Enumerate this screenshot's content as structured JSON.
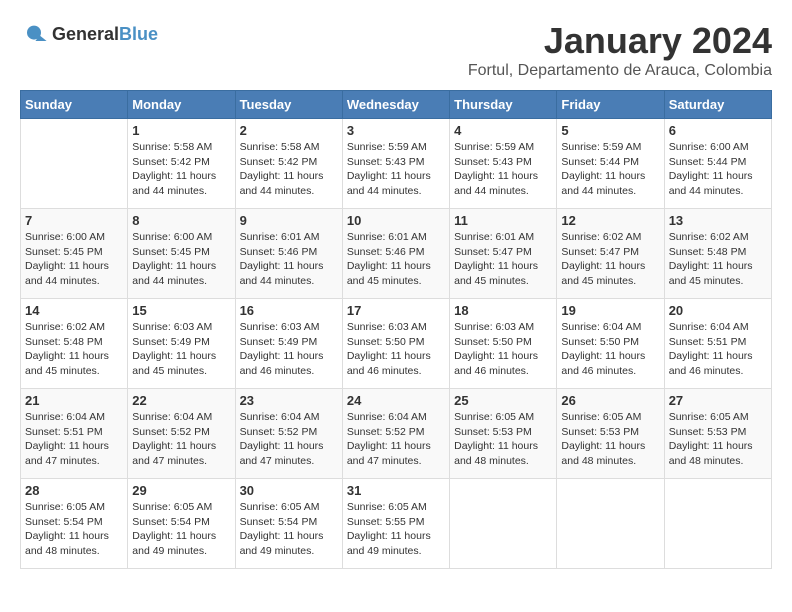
{
  "header": {
    "logo_general": "General",
    "logo_blue": "Blue",
    "month_title": "January 2024",
    "location": "Fortul, Departamento de Arauca, Colombia"
  },
  "days_of_week": [
    "Sunday",
    "Monday",
    "Tuesday",
    "Wednesday",
    "Thursday",
    "Friday",
    "Saturday"
  ],
  "weeks": [
    [
      {
        "day": "",
        "info": ""
      },
      {
        "day": "1",
        "info": "Sunrise: 5:58 AM\nSunset: 5:42 PM\nDaylight: 11 hours\nand 44 minutes."
      },
      {
        "day": "2",
        "info": "Sunrise: 5:58 AM\nSunset: 5:42 PM\nDaylight: 11 hours\nand 44 minutes."
      },
      {
        "day": "3",
        "info": "Sunrise: 5:59 AM\nSunset: 5:43 PM\nDaylight: 11 hours\nand 44 minutes."
      },
      {
        "day": "4",
        "info": "Sunrise: 5:59 AM\nSunset: 5:43 PM\nDaylight: 11 hours\nand 44 minutes."
      },
      {
        "day": "5",
        "info": "Sunrise: 5:59 AM\nSunset: 5:44 PM\nDaylight: 11 hours\nand 44 minutes."
      },
      {
        "day": "6",
        "info": "Sunrise: 6:00 AM\nSunset: 5:44 PM\nDaylight: 11 hours\nand 44 minutes."
      }
    ],
    [
      {
        "day": "7",
        "info": "Sunrise: 6:00 AM\nSunset: 5:45 PM\nDaylight: 11 hours\nand 44 minutes."
      },
      {
        "day": "8",
        "info": "Sunrise: 6:00 AM\nSunset: 5:45 PM\nDaylight: 11 hours\nand 44 minutes."
      },
      {
        "day": "9",
        "info": "Sunrise: 6:01 AM\nSunset: 5:46 PM\nDaylight: 11 hours\nand 44 minutes."
      },
      {
        "day": "10",
        "info": "Sunrise: 6:01 AM\nSunset: 5:46 PM\nDaylight: 11 hours\nand 45 minutes."
      },
      {
        "day": "11",
        "info": "Sunrise: 6:01 AM\nSunset: 5:47 PM\nDaylight: 11 hours\nand 45 minutes."
      },
      {
        "day": "12",
        "info": "Sunrise: 6:02 AM\nSunset: 5:47 PM\nDaylight: 11 hours\nand 45 minutes."
      },
      {
        "day": "13",
        "info": "Sunrise: 6:02 AM\nSunset: 5:48 PM\nDaylight: 11 hours\nand 45 minutes."
      }
    ],
    [
      {
        "day": "14",
        "info": "Sunrise: 6:02 AM\nSunset: 5:48 PM\nDaylight: 11 hours\nand 45 minutes."
      },
      {
        "day": "15",
        "info": "Sunrise: 6:03 AM\nSunset: 5:49 PM\nDaylight: 11 hours\nand 45 minutes."
      },
      {
        "day": "16",
        "info": "Sunrise: 6:03 AM\nSunset: 5:49 PM\nDaylight: 11 hours\nand 46 minutes."
      },
      {
        "day": "17",
        "info": "Sunrise: 6:03 AM\nSunset: 5:50 PM\nDaylight: 11 hours\nand 46 minutes."
      },
      {
        "day": "18",
        "info": "Sunrise: 6:03 AM\nSunset: 5:50 PM\nDaylight: 11 hours\nand 46 minutes."
      },
      {
        "day": "19",
        "info": "Sunrise: 6:04 AM\nSunset: 5:50 PM\nDaylight: 11 hours\nand 46 minutes."
      },
      {
        "day": "20",
        "info": "Sunrise: 6:04 AM\nSunset: 5:51 PM\nDaylight: 11 hours\nand 46 minutes."
      }
    ],
    [
      {
        "day": "21",
        "info": "Sunrise: 6:04 AM\nSunset: 5:51 PM\nDaylight: 11 hours\nand 47 minutes."
      },
      {
        "day": "22",
        "info": "Sunrise: 6:04 AM\nSunset: 5:52 PM\nDaylight: 11 hours\nand 47 minutes."
      },
      {
        "day": "23",
        "info": "Sunrise: 6:04 AM\nSunset: 5:52 PM\nDaylight: 11 hours\nand 47 minutes."
      },
      {
        "day": "24",
        "info": "Sunrise: 6:04 AM\nSunset: 5:52 PM\nDaylight: 11 hours\nand 47 minutes."
      },
      {
        "day": "25",
        "info": "Sunrise: 6:05 AM\nSunset: 5:53 PM\nDaylight: 11 hours\nand 48 minutes."
      },
      {
        "day": "26",
        "info": "Sunrise: 6:05 AM\nSunset: 5:53 PM\nDaylight: 11 hours\nand 48 minutes."
      },
      {
        "day": "27",
        "info": "Sunrise: 6:05 AM\nSunset: 5:53 PM\nDaylight: 11 hours\nand 48 minutes."
      }
    ],
    [
      {
        "day": "28",
        "info": "Sunrise: 6:05 AM\nSunset: 5:54 PM\nDaylight: 11 hours\nand 48 minutes."
      },
      {
        "day": "29",
        "info": "Sunrise: 6:05 AM\nSunset: 5:54 PM\nDaylight: 11 hours\nand 49 minutes."
      },
      {
        "day": "30",
        "info": "Sunrise: 6:05 AM\nSunset: 5:54 PM\nDaylight: 11 hours\nand 49 minutes."
      },
      {
        "day": "31",
        "info": "Sunrise: 6:05 AM\nSunset: 5:55 PM\nDaylight: 11 hours\nand 49 minutes."
      },
      {
        "day": "",
        "info": ""
      },
      {
        "day": "",
        "info": ""
      },
      {
        "day": "",
        "info": ""
      }
    ]
  ]
}
